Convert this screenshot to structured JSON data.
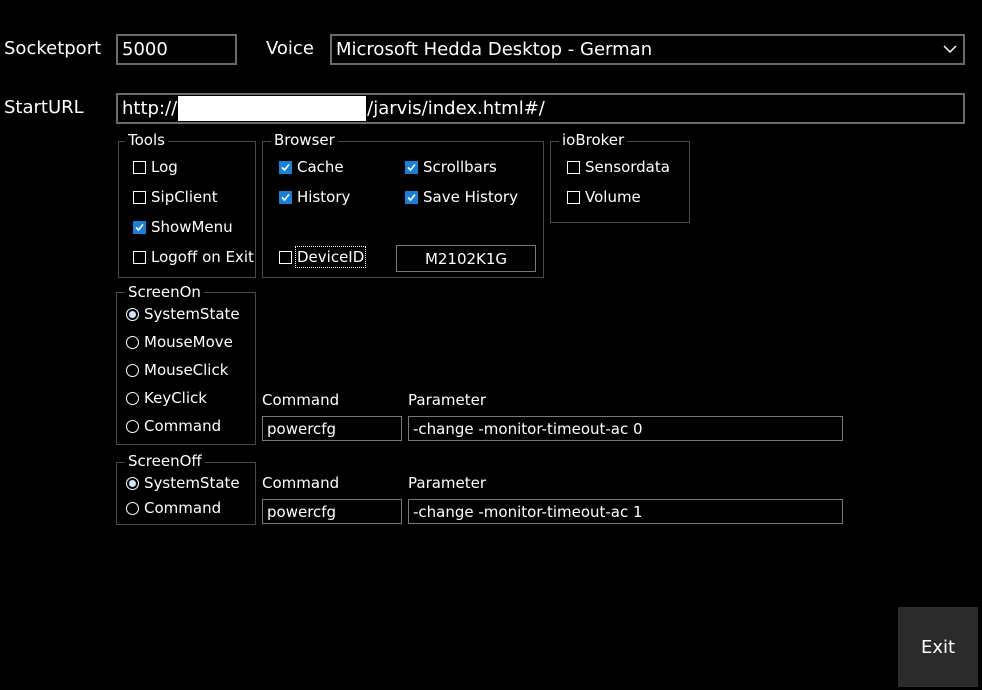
{
  "socketport": {
    "label": "Socketport",
    "value": "5000"
  },
  "voice": {
    "label": "Voice",
    "selected": "Microsoft Hedda Desktop - German"
  },
  "start_url": {
    "label": "StartURL",
    "prefix": "http://",
    "suffix": "/jarvis/index.html#/"
  },
  "tools": {
    "title": "Tools",
    "items": [
      {
        "label": "Log",
        "checked": false
      },
      {
        "label": "SipClient",
        "checked": false
      },
      {
        "label": "ShowMenu",
        "checked": true
      },
      {
        "label": "Logoff on Exit",
        "checked": false
      }
    ]
  },
  "browser": {
    "title": "Browser",
    "items": [
      {
        "label": "Cache",
        "checked": true
      },
      {
        "label": "Scrollbars",
        "checked": true
      },
      {
        "label": "History",
        "checked": true
      },
      {
        "label": "Save History",
        "checked": true
      }
    ],
    "device_id": {
      "label": "DeviceID",
      "checked": false,
      "value": "M2102K1G"
    }
  },
  "iobroker": {
    "title": "ioBroker",
    "items": [
      {
        "label": "Sensordata",
        "checked": false
      },
      {
        "label": "Volume",
        "checked": false
      }
    ]
  },
  "screen_on": {
    "title": "ScreenOn",
    "options": [
      "SystemState",
      "MouseMove",
      "MouseClick",
      "KeyClick",
      "Command"
    ],
    "selected": "SystemState",
    "command_label": "Command",
    "parameter_label": "Parameter",
    "command": "powercfg",
    "parameter": "-change -monitor-timeout-ac 0"
  },
  "screen_off": {
    "title": "ScreenOff",
    "options": [
      "SystemState",
      "Command"
    ],
    "selected": "SystemState",
    "command_label": "Command",
    "parameter_label": "Parameter",
    "command": "powercfg",
    "parameter": "-change -monitor-timeout-ac 1"
  },
  "exit_label": "Exit",
  "colors": {
    "background": "#000000",
    "accent": "#1a7fd6",
    "button": "#2b2b2b"
  }
}
